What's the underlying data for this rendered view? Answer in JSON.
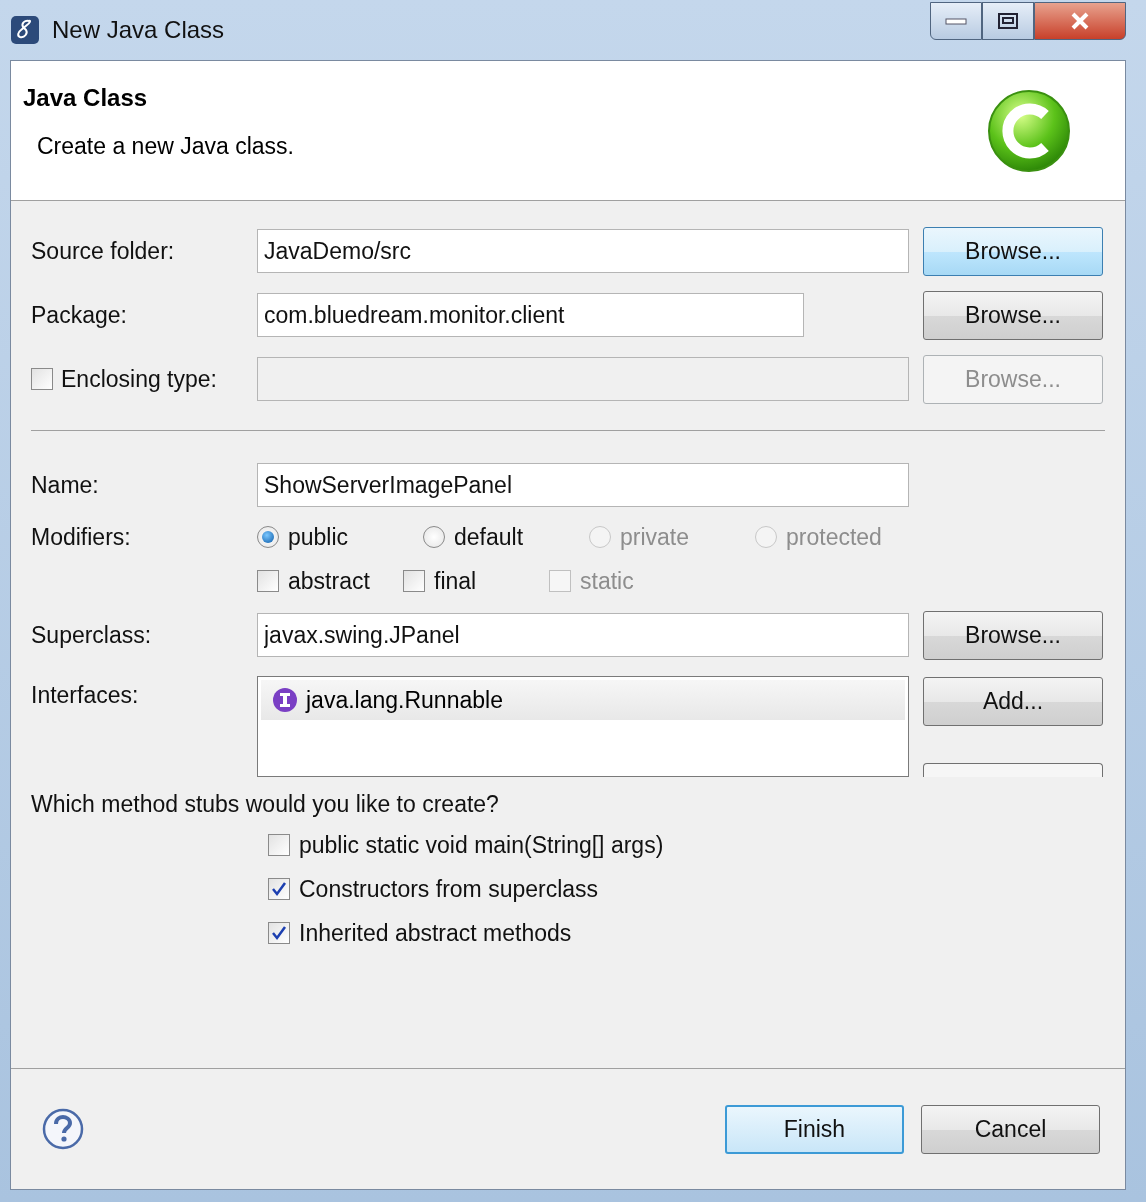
{
  "window": {
    "title": "New Java Class"
  },
  "header": {
    "title": "Java Class",
    "description": "Create a new Java class."
  },
  "rows": [
    {
      "kind": "text",
      "label": "Source folder:",
      "value": "JavaDemo/src",
      "short": false,
      "button": {
        "label": "Browse...",
        "hot": true,
        "disabled": false
      }
    },
    {
      "kind": "text",
      "label": "Package:",
      "value": "com.bluedream.monitor.client",
      "short": true,
      "button": {
        "label": "Browse...",
        "hot": false,
        "disabled": false
      }
    },
    {
      "kind": "checktext",
      "label": "Enclosing type:",
      "checked": false,
      "disabled": true,
      "short": false,
      "button": {
        "label": "Browse...",
        "hot": false,
        "disabled": true
      }
    },
    {
      "kind": "separator"
    },
    {
      "kind": "text",
      "label": "Name:",
      "value": "ShowServerImagePanel",
      "short": false
    },
    {
      "kind": "modifiers",
      "label": "Modifiers:",
      "radios": [
        {
          "label": "public",
          "selected": true,
          "disabled": false
        },
        {
          "label": "default",
          "selected": false,
          "disabled": false
        },
        {
          "label": "private",
          "selected": false,
          "disabled": true
        },
        {
          "label": "protected",
          "selected": false,
          "disabled": true
        }
      ],
      "checks": [
        {
          "label": "abstract",
          "checked": false,
          "disabled": false
        },
        {
          "label": "final",
          "checked": false,
          "disabled": false
        },
        {
          "label": "static",
          "checked": false,
          "disabled": true
        }
      ]
    },
    {
      "kind": "text",
      "label": "Superclass:",
      "value": "javax.swing.JPanel",
      "short": false,
      "button": {
        "label": "Browse...",
        "hot": false,
        "disabled": false
      }
    },
    {
      "kind": "list",
      "label": "Interfaces:",
      "items": [
        "java.lang.Runnable"
      ],
      "button": {
        "label": "Add...",
        "hot": false,
        "disabled": false
      }
    }
  ],
  "stubs": {
    "question": "Which method stubs would you like to create?",
    "options": [
      {
        "label": "public static void main(String[] args)",
        "checked": false
      },
      {
        "label": "Constructors from superclass",
        "checked": true
      },
      {
        "label": "Inherited abstract methods",
        "checked": true
      }
    ]
  },
  "footer": {
    "buttons": [
      {
        "label": "Finish",
        "default": true
      },
      {
        "label": "Cancel",
        "default": false
      }
    ]
  }
}
